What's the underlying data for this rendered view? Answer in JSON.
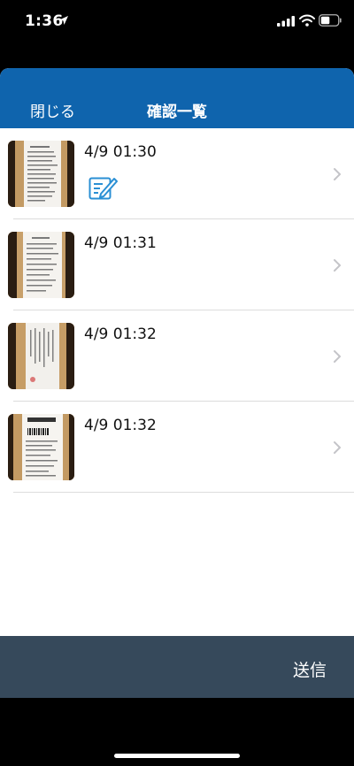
{
  "status_bar": {
    "time": "1:36",
    "icons": [
      "location-arrow-icon",
      "cellular-signal-icon",
      "wifi-icon",
      "battery-icon"
    ]
  },
  "nav": {
    "close_label": "閉じる",
    "title": "確認一覧"
  },
  "items": [
    {
      "time": "4/9 01:30",
      "edited": true
    },
    {
      "time": "4/9 01:31",
      "edited": false
    },
    {
      "time": "4/9 01:32",
      "edited": false
    },
    {
      "time": "4/9 01:32",
      "edited": false
    }
  ],
  "bottom_bar": {
    "send_label": "送信"
  },
  "colors": {
    "nav_background": "#0f64ad",
    "bottom_bar_background": "#36495b",
    "edit_icon": "#2a8fd4"
  }
}
